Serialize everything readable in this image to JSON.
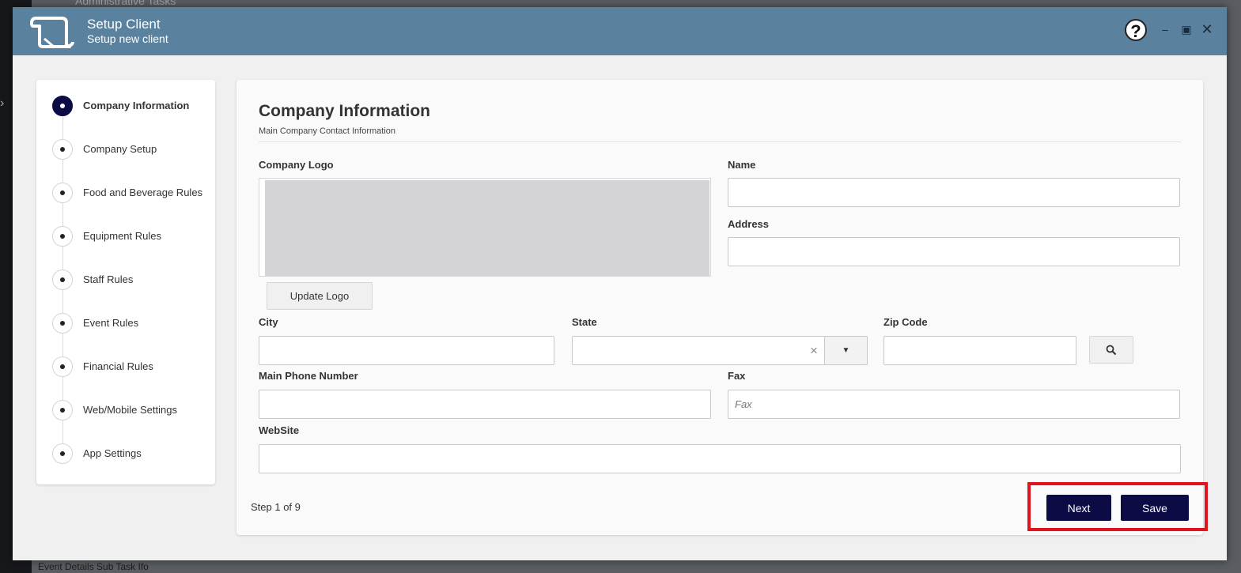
{
  "background": {
    "top_text": "Administrative Tasks",
    "bottom_text": "Event Details Sub Task Ifo"
  },
  "header": {
    "title": "Setup Client",
    "subtitle": "Setup new client",
    "help_glyph": "?",
    "minimize_glyph": "–",
    "maximize_glyph": "▣",
    "close_glyph": "✕"
  },
  "stepper": {
    "items": [
      {
        "label": "Company Information",
        "active": true
      },
      {
        "label": "Company Setup",
        "active": false
      },
      {
        "label": "Food and Beverage Rules",
        "active": false
      },
      {
        "label": "Equipment Rules",
        "active": false
      },
      {
        "label": "Staff Rules",
        "active": false
      },
      {
        "label": "Event Rules",
        "active": false
      },
      {
        "label": "Financial Rules",
        "active": false
      },
      {
        "label": "Web/Mobile Settings",
        "active": false
      },
      {
        "label": "App Settings",
        "active": false
      }
    ]
  },
  "form": {
    "title": "Company Information",
    "subtitle": "Main Company Contact Information",
    "company_logo_label": "Company Logo",
    "update_logo_label": "Update Logo",
    "name_label": "Name",
    "name_value": "",
    "address_label": "Address",
    "address_value": "",
    "city_label": "City",
    "city_value": "",
    "state_label": "State",
    "state_value": "",
    "zip_label": "Zip Code",
    "zip_value": "",
    "phone_label": "Main Phone Number",
    "phone_value": "",
    "fax_label": "Fax",
    "fax_placeholder": "Fax",
    "website_label": "WebSite",
    "website_value": ""
  },
  "footer": {
    "step_count": "Step 1 of 9",
    "next_label": "Next",
    "save_label": "Save"
  },
  "colors": {
    "header_bg": "#5a829e",
    "primary_button": "#0d0b45",
    "highlight_border": "#e0131f"
  },
  "icons": {
    "logo": "scroll-icon",
    "zip_lookup": "search-icon"
  }
}
